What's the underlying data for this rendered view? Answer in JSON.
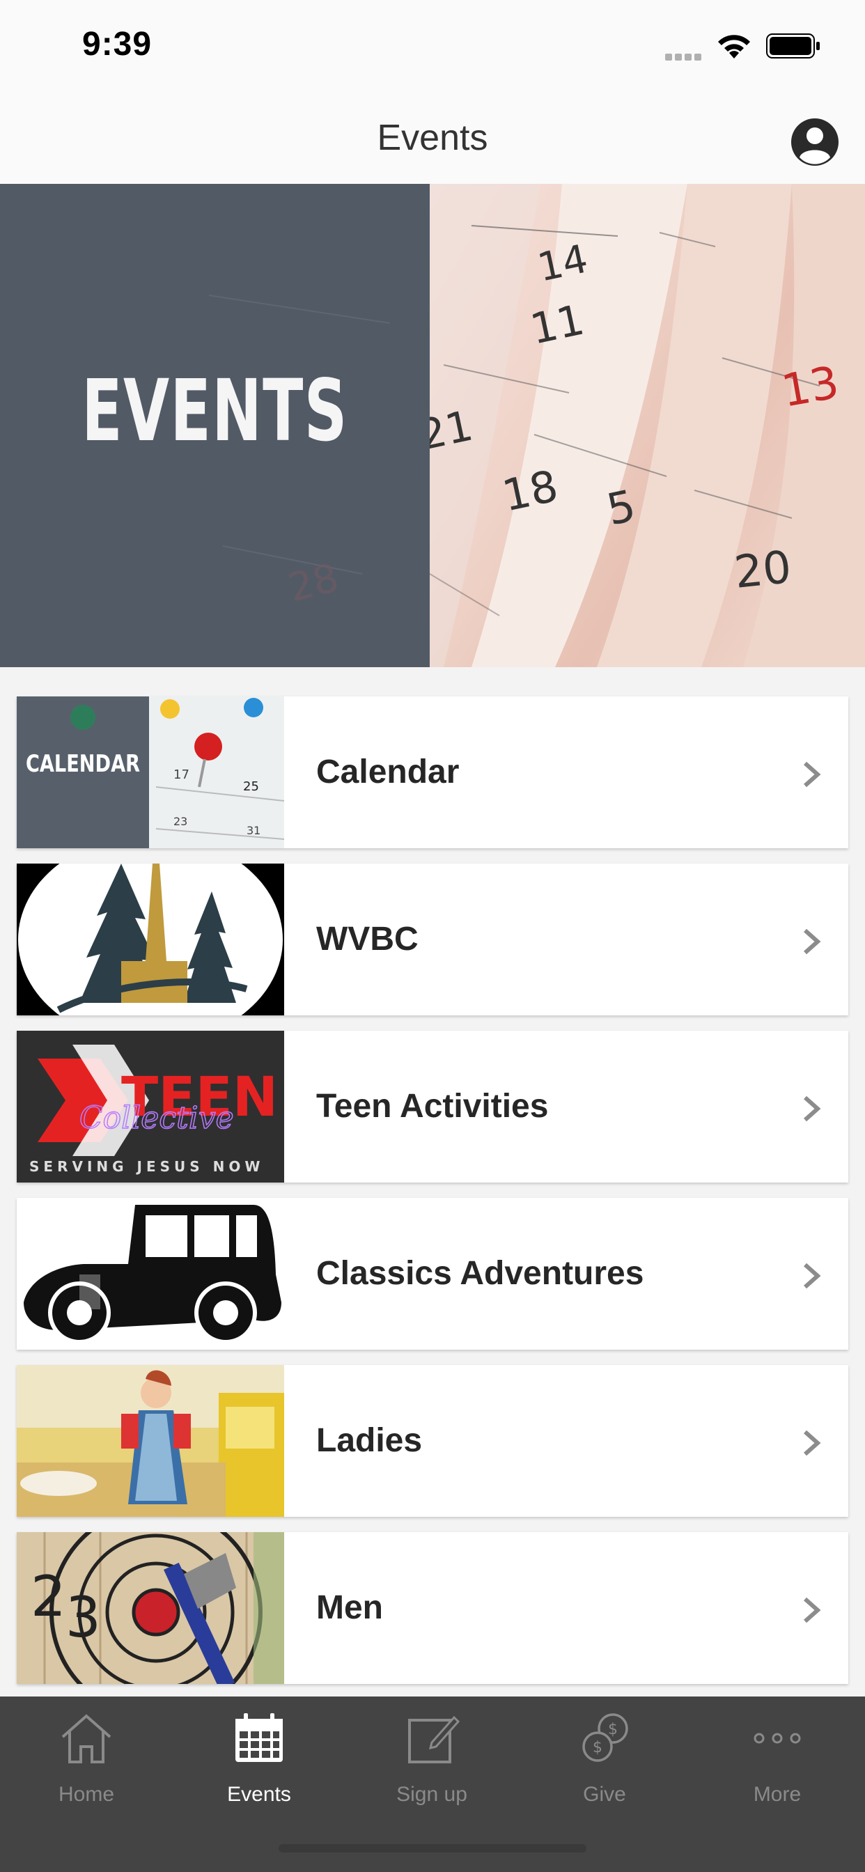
{
  "status_bar": {
    "time": "9:39"
  },
  "header": {
    "title": "Events"
  },
  "hero": {
    "title": "EVENTS",
    "calendar_numbers": [
      "14",
      "11",
      "13",
      "21",
      "18",
      "5",
      "20",
      "28"
    ]
  },
  "events": [
    {
      "label": "Calendar",
      "thumb_text": "CALENDAR"
    },
    {
      "label": "WVBC"
    },
    {
      "label": "Teen Activities",
      "thumb_text_1": "TEEN",
      "thumb_text_2": "Collective",
      "thumb_text_3": "SERVING JESUS NOW"
    },
    {
      "label": "Classics Adventures"
    },
    {
      "label": "Ladies"
    },
    {
      "label": "Men"
    }
  ],
  "tabs": [
    {
      "label": "Home",
      "icon": "home-icon",
      "active": false
    },
    {
      "label": "Events",
      "icon": "calendar-icon",
      "active": true
    },
    {
      "label": "Sign up",
      "icon": "edit-icon",
      "active": false
    },
    {
      "label": "Give",
      "icon": "coins-icon",
      "active": false
    },
    {
      "label": "More",
      "icon": "more-icon",
      "active": false
    }
  ],
  "colors": {
    "tab_bar_bg": "#444444",
    "tab_active": "#ffffff",
    "tab_inactive": "#8a8a8a",
    "hero_overlay": "#525a66"
  }
}
